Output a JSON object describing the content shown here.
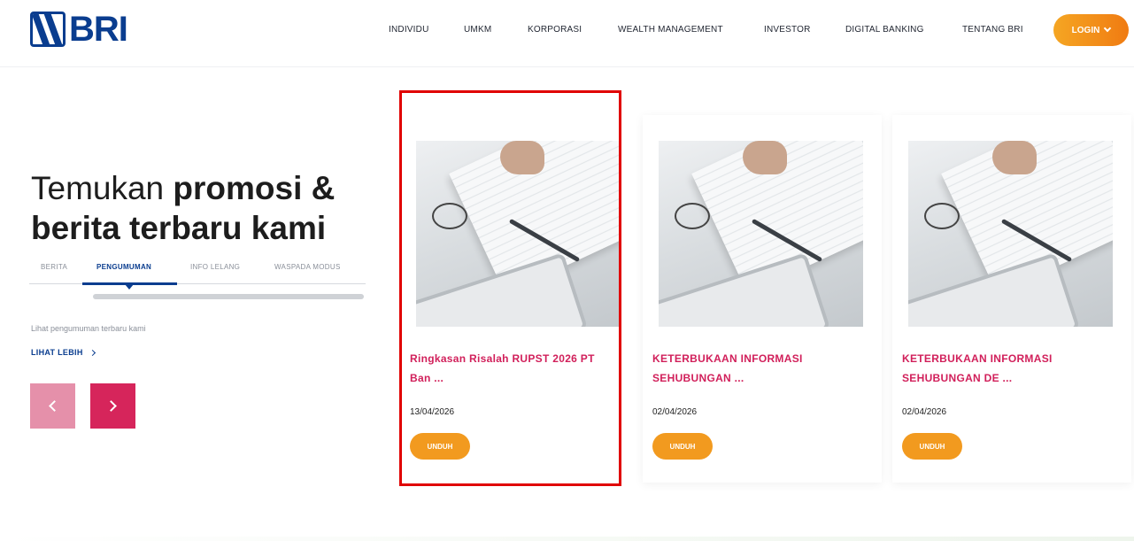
{
  "header": {
    "logo_text": "BRI",
    "nav": [
      "INDIVIDU",
      "UMKM",
      "KORPORASI",
      "WEALTH MANAGEMENT",
      "INVESTOR",
      "DIGITAL BANKING",
      "TENTANG BRI"
    ],
    "login_label": "LOGIN"
  },
  "promo": {
    "headline_part1": "Temukan ",
    "headline_bold1": "promosi &",
    "headline_line2": "berita terbaru kami",
    "tabs": [
      "BERITA",
      "PENGUMUMAN",
      "INFO LELANG",
      "WASPADA MODUS"
    ],
    "active_tab": "PENGUMUMAN",
    "subtext": "Lihat pengumuman terbaru kami",
    "see_more": "LIHAT LEBIH"
  },
  "cards": [
    {
      "title": "Ringkasan Risalah RUPST 2026 PT Ban ...",
      "date": "13/04/2026",
      "button": "UNDUH"
    },
    {
      "title": "KETERBUKAAN INFORMASI SEHUBUNGAN ...",
      "date": "02/04/2026",
      "button": "UNDUH"
    },
    {
      "title": "KETERBUKAAN INFORMASI SEHUBUNGAN DE ...",
      "date": "02/04/2026",
      "button": "UNDUH"
    }
  ],
  "colors": {
    "brand_blue": "#0a3d8f",
    "accent_orange": "#f29a1f",
    "title_pink": "#d11f5a",
    "highlight_red": "#e00000"
  }
}
